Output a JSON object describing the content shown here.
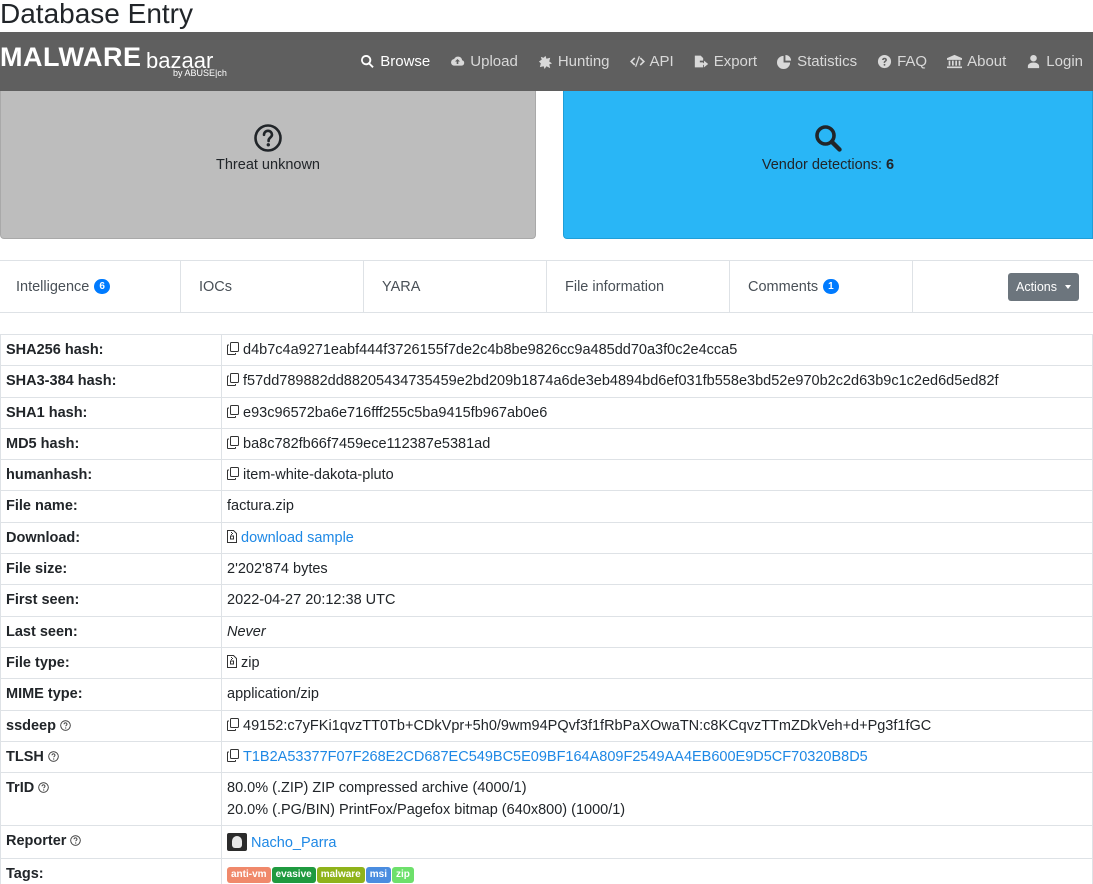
{
  "page": {
    "title": "Database Entry"
  },
  "logo": {
    "main": "MALWARE",
    "sub": "bazaar",
    "by": "by ABUSE|ch"
  },
  "nav": [
    {
      "label": "Browse",
      "icon": "search-icon",
      "active": true
    },
    {
      "label": "Upload",
      "icon": "cloud-upload-icon",
      "active": false
    },
    {
      "label": "Hunting",
      "icon": "hunting-icon",
      "active": false
    },
    {
      "label": "API",
      "icon": "code-icon",
      "active": false
    },
    {
      "label": "Export",
      "icon": "export-icon",
      "active": false
    },
    {
      "label": "Statistics",
      "icon": "pie-chart-icon",
      "active": false
    },
    {
      "label": "FAQ",
      "icon": "question-circle-icon",
      "active": false
    },
    {
      "label": "About",
      "icon": "building-icon",
      "active": false
    },
    {
      "label": "Login",
      "icon": "user-icon",
      "active": false
    }
  ],
  "cards": {
    "threat": {
      "text": "Threat unknown",
      "color": "#bdbdbd",
      "icon": "question-circle-icon"
    },
    "vendor": {
      "label": "Vendor detections:",
      "count": "6",
      "color": "#29b6f6",
      "icon": "search-icon"
    }
  },
  "tabs": {
    "intelligence": {
      "label": "Intelligence",
      "badge": "6"
    },
    "iocs": {
      "label": "IOCs"
    },
    "yara": {
      "label": "YARA"
    },
    "file_info": {
      "label": "File information"
    },
    "comments": {
      "label": "Comments",
      "badge": "1"
    },
    "actions": {
      "label": "Actions"
    }
  },
  "info": {
    "sha256": {
      "label": "SHA256 hash:",
      "value": "d4b7c4a9271eabf444f3726155f7de2c4b8be9826cc9a485dd70a3f0c2e4cca5"
    },
    "sha3": {
      "label": "SHA3-384 hash:",
      "value": "f57dd789882dd88205434735459e2bd209b1874a6de3eb4894bd6ef031fb558e3bd52e970b2c2d63b9c1c2ed6d5ed82f"
    },
    "sha1": {
      "label": "SHA1 hash:",
      "value": "e93c96572ba6e716fff255c5ba9415fb967ab0e6"
    },
    "md5": {
      "label": "MD5 hash:",
      "value": "ba8c782fb66f7459ece112387e5381ad"
    },
    "humanhash": {
      "label": "humanhash:",
      "value": "item-white-dakota-pluto"
    },
    "file_name": {
      "label": "File name:",
      "value": "factura.zip"
    },
    "download": {
      "label": "Download:",
      "value": "download sample"
    },
    "file_size": {
      "label": "File size:",
      "value": "2'202'874 bytes"
    },
    "first_seen": {
      "label": "First seen:",
      "value": "2022-04-27 20:12:38 UTC"
    },
    "last_seen": {
      "label": "Last seen:",
      "value": "Never"
    },
    "file_type": {
      "label": "File type:",
      "value": "zip"
    },
    "mime_type": {
      "label": "MIME type:",
      "value": "application/zip"
    },
    "ssdeep": {
      "label": "ssdeep",
      "value": "49152:c7yFKi1qvzTT0Tb+CDkVpr+5h0/9wm94PQvf3f1fRbPaXOwaTN:c8KCqvzTTmZDkVeh+d+Pg3f1fGC"
    },
    "tlsh": {
      "label": "TLSH",
      "value": "T1B2A53377F07F268E2CD687EC549BC5E09BF164A809F2549AA4EB600E9D5CF70320B8D5"
    },
    "trid": {
      "label": "TrID",
      "line1": "80.0% (.ZIP) ZIP compressed archive (4000/1)",
      "line2": "20.0% (.PG/BIN) PrintFox/Pagefox bitmap (640x800) (1000/1)"
    },
    "reporter": {
      "label": "Reporter",
      "value": "Nacho_Parra"
    },
    "tags": {
      "label": "Tags:",
      "items": [
        {
          "text": "anti-vm",
          "color": "#f0896b"
        },
        {
          "text": "evasive",
          "color": "#1f9a3f"
        },
        {
          "text": "malware",
          "color": "#8fb31a"
        },
        {
          "text": "msi",
          "color": "#4a8de0"
        },
        {
          "text": "zip",
          "color": "#6de06b"
        }
      ]
    }
  }
}
